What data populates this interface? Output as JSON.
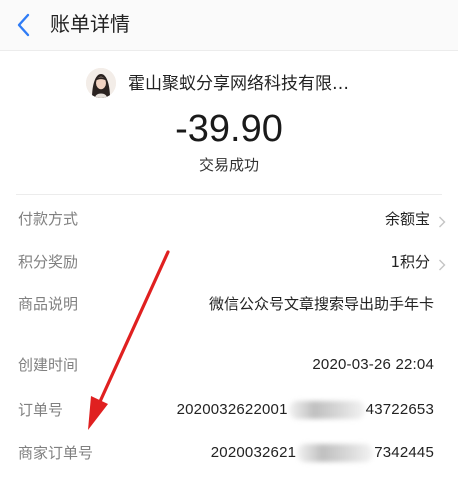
{
  "header": {
    "title": "账单详情",
    "back_icon": "chevron-left-icon",
    "accent_color": "#2f7cf6"
  },
  "merchant": {
    "name": "霍山聚蚁分享网络科技有限…",
    "avatar_icon": "avatar-photo"
  },
  "amount": "-39.90",
  "status": "交易成功",
  "details": [
    {
      "label": "付款方式",
      "value": "余额宝",
      "arrow": true
    },
    {
      "label": "积分奖励",
      "value": "1积分",
      "arrow": true
    },
    {
      "label": "商品说明",
      "value": "微信公众号文章搜索导出助手年卡",
      "arrow": false
    },
    {
      "label": "创建时间",
      "value": "2020-03-26 22:04",
      "arrow": false
    },
    {
      "label": "订单号",
      "value_start": "2020032622001",
      "value_end": "43722653",
      "arrow": false
    },
    {
      "label": "商家订单号",
      "value_start": "2020032621",
      "value_end": "7342445",
      "arrow": false
    }
  ],
  "annotation": {
    "color": "#e02020",
    "icon": "red-arrow-annotation"
  }
}
